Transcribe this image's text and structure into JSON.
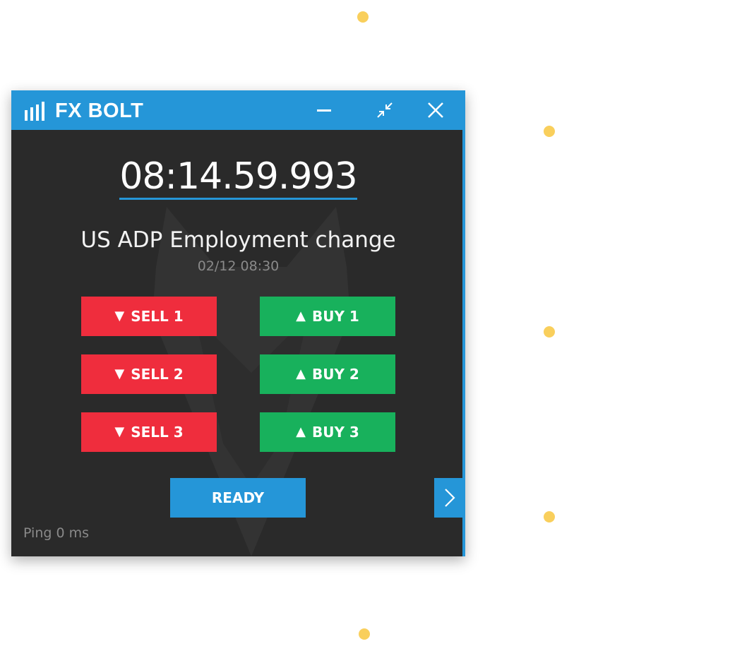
{
  "app": {
    "title": "FX BOLT",
    "accent_color": "#2596d8",
    "controls": {
      "minimize_icon": "minimize-icon",
      "collapse_icon": "collapse-icon",
      "close_icon": "close-icon"
    }
  },
  "countdown": {
    "value": "08:14.59.993"
  },
  "event": {
    "title": "US ADP Employment change",
    "datetime": "02/12 08:30"
  },
  "orders": {
    "sell": [
      {
        "label": "SELL 1",
        "icon": "triangle-down-icon"
      },
      {
        "label": "SELL 2",
        "icon": "triangle-down-icon"
      },
      {
        "label": "SELL 3",
        "icon": "triangle-down-icon"
      }
    ],
    "buy": [
      {
        "label": "BUY 1",
        "icon": "triangle-up-icon"
      },
      {
        "label": "BUY 2",
        "icon": "triangle-up-icon"
      },
      {
        "label": "BUY 3",
        "icon": "triangle-up-icon"
      }
    ],
    "sell_color": "#ef2d3d",
    "buy_color": "#18b15c"
  },
  "footer": {
    "ready_label": "READY",
    "next_icon": "chevron-right-icon",
    "ping_text": "Ping 0 ms"
  },
  "decor": {
    "dot_color": "#f9cf5c"
  }
}
